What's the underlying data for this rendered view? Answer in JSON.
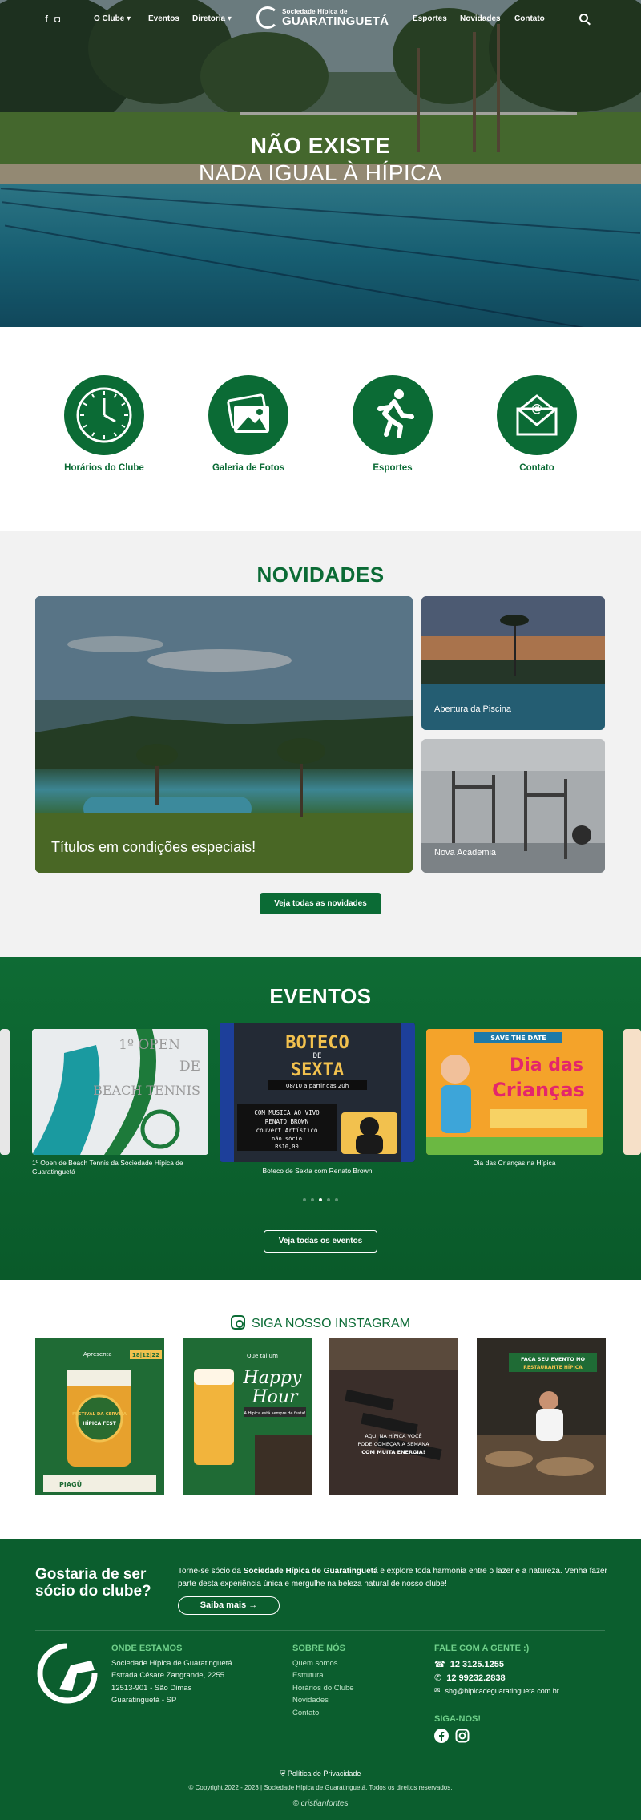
{
  "nav": {
    "left_links": [
      {
        "label": "O Clube",
        "has_dropdown": true
      },
      {
        "label": "Eventos",
        "has_dropdown": false
      },
      {
        "label": "Diretoria",
        "has_dropdown": true
      }
    ],
    "right_links": [
      {
        "label": "Esportes"
      },
      {
        "label": "Novidades"
      },
      {
        "label": "Contato"
      }
    ],
    "logo_line1": "Sociedade Hípica de",
    "logo_line2": "GUARATINGUETÁ"
  },
  "hero": {
    "title_bold": "NÃO EXISTE",
    "title_light": "NADA IGUAL À HÍPICA"
  },
  "quick_links": [
    {
      "label": "Horários do Clube",
      "icon": "clock-icon"
    },
    {
      "label": "Galeria de Fotos",
      "icon": "photos-icon"
    },
    {
      "label": "Esportes",
      "icon": "runner-icon"
    },
    {
      "label": "Contato",
      "icon": "envelope-icon"
    }
  ],
  "news": {
    "title": "NOVIDADES",
    "featured": "Títulos em condições especiais!",
    "items": [
      "Abertura da Piscina",
      "Nova Academia"
    ],
    "button": "Veja todas as novidades"
  },
  "events": {
    "title": "EVENTOS",
    "cards": [
      {
        "caption": "1º Open de Beach Tennis da Sociedade Hípica de Guaratinguetá",
        "art_lines": [
          "1º OPEN",
          "DE",
          "BEACH TENNIS"
        ]
      },
      {
        "caption": "Boteco de Sexta com Renato Brown",
        "art_lines": [
          "BOTECO",
          "DE",
          "SEXTA",
          "08/10 a partir das 20h",
          "COM MUSICA AO VIVO",
          "RENATO BROWN",
          "couvert Artístico",
          "não sócio",
          "R$10,00"
        ]
      },
      {
        "caption": "Dia das Crianças na Hípica",
        "art_lines": [
          "SAVE THE DATE",
          "Dia das",
          "Crianças"
        ]
      }
    ],
    "button": "Veja todas os eventos",
    "slides": 5,
    "active_slide": 3
  },
  "instagram": {
    "title": "SIGA NOSSO INSTAGRAM",
    "posts": [
      {
        "art": [
          "Apresenta",
          "FESTIVAL DA CERVEJA",
          "HÍPICA FEST",
          "18|12|22",
          "PIAGÜ"
        ]
      },
      {
        "art": [
          "Que tal um",
          "Happy",
          "Hour",
          "A Hípica está sempre de festa!"
        ]
      },
      {
        "art": [
          "AQUI NA HÍPICA VOCÊ",
          "PODE COMEÇAR A SEMANA",
          "COM MUITA ENERGIA!"
        ]
      },
      {
        "art": [
          "FAÇA SEU EVENTO NO",
          "RESTAURANTE HÍPICA"
        ]
      }
    ]
  },
  "footer": {
    "cta_title": "Gostaria de ser sócio do clube?",
    "cta_text_pre": "Torne-se sócio da ",
    "cta_text_bold": "Sociedade Hípica de Guaratinguetá",
    "cta_text_post": " e explore toda harmonia entre o lazer e a natureza. Venha fazer parte desta experiência única e mergulhe na beleza natural de nosso clube!",
    "cta_button": "Saiba mais",
    "where_title": "ONDE ESTAMOS",
    "address": [
      "Sociedade Hípica de Guaratinguetá",
      "Estrada Césare Zangrande, 2255",
      "12513-901  -  São Dimas",
      "Guaratinguetá - SP"
    ],
    "about_title": "SOBRE NÓS",
    "about_links": [
      "Quem somos",
      "Estrutura",
      "Horários do Clube",
      "Novidades",
      "Contato"
    ],
    "contact_title": "FALE COM A GENTE :)",
    "phone": "12 3125.1255",
    "whatsapp": "12 99232.2838",
    "email": "shg@hipicadeguaratingueta.com.br",
    "follow_title": "SIGA-NOS!",
    "policy": "Política de Privacidade",
    "copyright": "© Copyright 2022 - 2023  |  Sociedade Hípica de Guaratinguetá. Todos os direitos reservados.",
    "credit": "cristianfontes"
  },
  "colors": {
    "brand_green": "#0b6b35",
    "footer_green": "#0b5e2e",
    "light_green": "#6fd08a"
  }
}
